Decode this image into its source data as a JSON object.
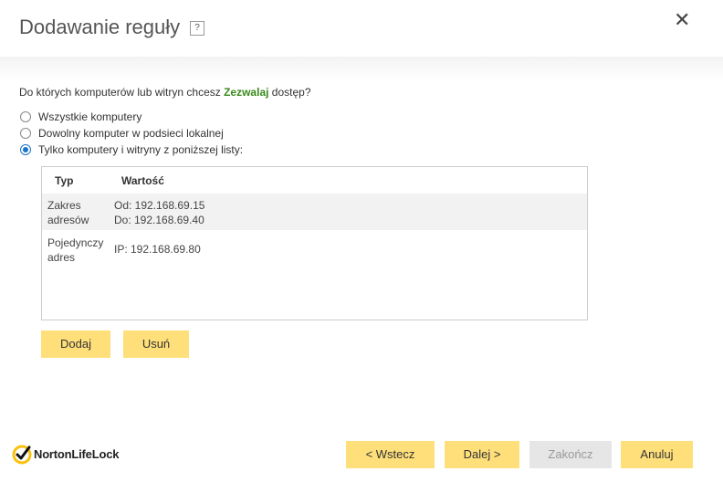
{
  "dialog": {
    "title": "Dodawanie reguły",
    "help_icon": "?",
    "close_icon": "✕"
  },
  "question": {
    "prefix": "Do których komputerów lub witryn chcesz ",
    "accent": "Zezwalaj",
    "suffix": " dostęp?",
    "accent_color": "#3a8a1e"
  },
  "options": [
    {
      "label": "Wszystkie komputery",
      "selected": false
    },
    {
      "label": "Dowolny komputer w podsieci lokalnej",
      "selected": false
    },
    {
      "label": "Tylko komputery i witryny z poniższej listy:",
      "selected": true
    }
  ],
  "table": {
    "headers": [
      "Typ",
      "Wartość"
    ],
    "rows": [
      {
        "type": [
          "Zakres",
          "adresów"
        ],
        "value": [
          "Od: 192.168.69.15",
          "Do: 192.168.69.40"
        ]
      },
      {
        "type": [
          "Pojedynczy",
          "adres"
        ],
        "value": [
          "IP: 192.168.69.80"
        ]
      }
    ]
  },
  "list_buttons": {
    "add": "Dodaj",
    "remove": "Usuń"
  },
  "footer": {
    "back": "< Wstecz",
    "next": "Dalej >",
    "finish": "Zakończ",
    "cancel": "Anuluj",
    "logo_text": "NortonLifeLock",
    "button_color": "#fedf7a",
    "logo_color": "#fcc10c"
  }
}
